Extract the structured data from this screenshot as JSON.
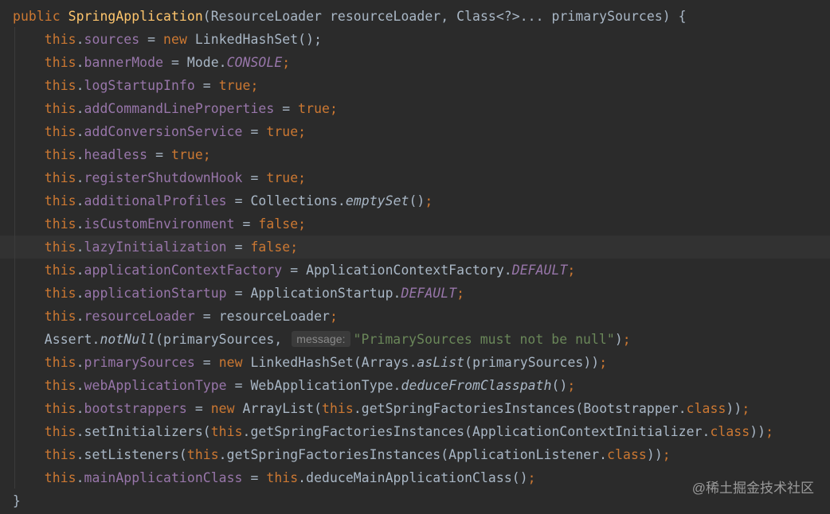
{
  "code": {
    "l0": {
      "kw": "public",
      "name": "SpringApplication",
      "params": "(ResourceLoader resourceLoader, Class<?>... primarySources) {"
    },
    "l1": {
      "field": "sources",
      "kw": "new",
      "rest": "LinkedHashSet();"
    },
    "l2": {
      "field": "bannerMode",
      "cls": "Mode.",
      "const": "CONSOLE"
    },
    "l3": {
      "field": "logStartupInfo",
      "val": "true"
    },
    "l4": {
      "field": "addCommandLineProperties",
      "val": "true"
    },
    "l5": {
      "field": "addConversionService",
      "val": "true"
    },
    "l6": {
      "field": "headless",
      "val": "true"
    },
    "l7": {
      "field": "registerShutdownHook",
      "val": "true"
    },
    "l8": {
      "field": "additionalProfiles",
      "cls": "Collections.",
      "method": "emptySet",
      "tail": "()"
    },
    "l9": {
      "field": "isCustomEnvironment",
      "val": "false"
    },
    "l10": {
      "field": "lazyInitialization",
      "val": "false"
    },
    "l11": {
      "field": "applicationContextFactory",
      "cls": "ApplicationContextFactory.",
      "const": "DEFAULT"
    },
    "l12": {
      "field": "applicationStartup",
      "cls": "ApplicationStartup.",
      "const": "DEFAULT"
    },
    "l13": {
      "field": "resourceLoader",
      "rest": "resourceLoader"
    },
    "l14": {
      "cls": "Assert.",
      "method": "notNull",
      "arg": "(primarySources,",
      "hint": "message:",
      "str": "\"PrimarySources must not be null\"",
      "tail": ")"
    },
    "l15": {
      "field": "primarySources",
      "kw": "new",
      "cls": "LinkedHashSet(Arrays.",
      "method": "asList",
      "tail": "(primarySources))"
    },
    "l16": {
      "field": "webApplicationType",
      "cls": "WebApplicationType.",
      "method": "deduceFromClasspath",
      "tail": "()"
    },
    "l17": {
      "field": "bootstrappers",
      "kw": "new",
      "rest": "ArrayList(",
      "this": "this",
      "call": ".getSpringFactoriesInstances(Bootstrapper.",
      "classkw": "class",
      "tail": "))"
    },
    "l18": {
      "method": "setInitializers(",
      "this": "this",
      "call": ".getSpringFactoriesInstances(ApplicationContextInitializer.",
      "classkw": "class",
      "tail": "))"
    },
    "l19": {
      "method": "setListeners(",
      "this": "this",
      "call": ".getSpringFactoriesInstances(ApplicationListener.",
      "classkw": "class",
      "tail": "))"
    },
    "l20": {
      "field": "mainApplicationClass",
      "this": "this",
      "call": ".deduceMainApplicationClass()"
    },
    "l21": {
      "brace": "}"
    },
    "this_kw": "this",
    "dot": ".",
    "semi": ";",
    "eq": " = "
  },
  "watermark": "@稀土掘金技术社区",
  "colors": {
    "background": "#2b2b2b",
    "keyword": "#cc7832",
    "field": "#9876aa",
    "method": "#ffc66d",
    "string": "#6a8759",
    "text": "#a9b7c6"
  }
}
